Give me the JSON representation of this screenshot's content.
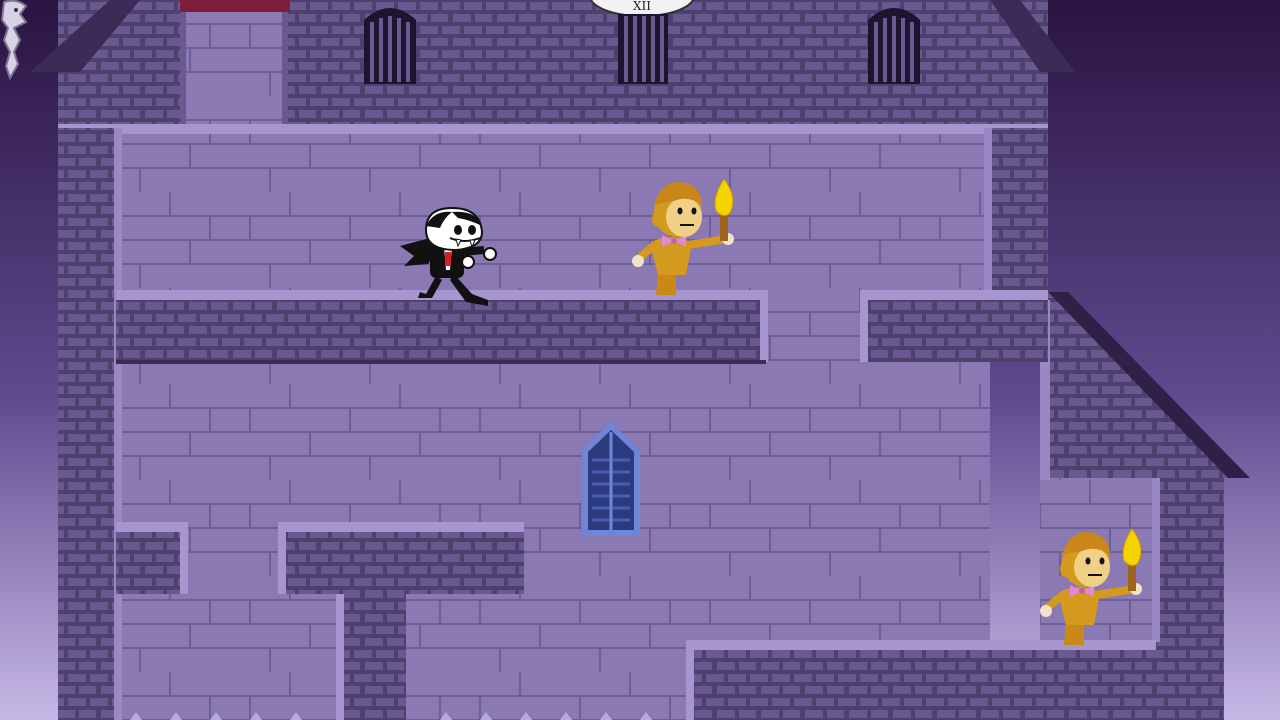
{
  "game": {
    "scene": "castle-level",
    "clock_numeral": "XII",
    "colors": {
      "sky_top": "#2a1442",
      "sky_bottom": "#c6b8e6",
      "brick": "#5b4b7a",
      "brick_mortar": "#7e6aa3",
      "wall_stone": "#8a79b3",
      "platform_top": "#a795cf",
      "window_blue": "#3a4c9a",
      "gold": "#d39a1e",
      "bowtie": "#e08ad6",
      "flame": "#f4d300"
    },
    "characters": [
      {
        "name": "vampire",
        "facing": "right"
      },
      {
        "name": "torch-guard",
        "facing": "left"
      },
      {
        "name": "torch-guard",
        "facing": "left"
      }
    ],
    "icons": [
      "gargoyle-icon",
      "clock-icon",
      "gothic-window-icon"
    ]
  }
}
